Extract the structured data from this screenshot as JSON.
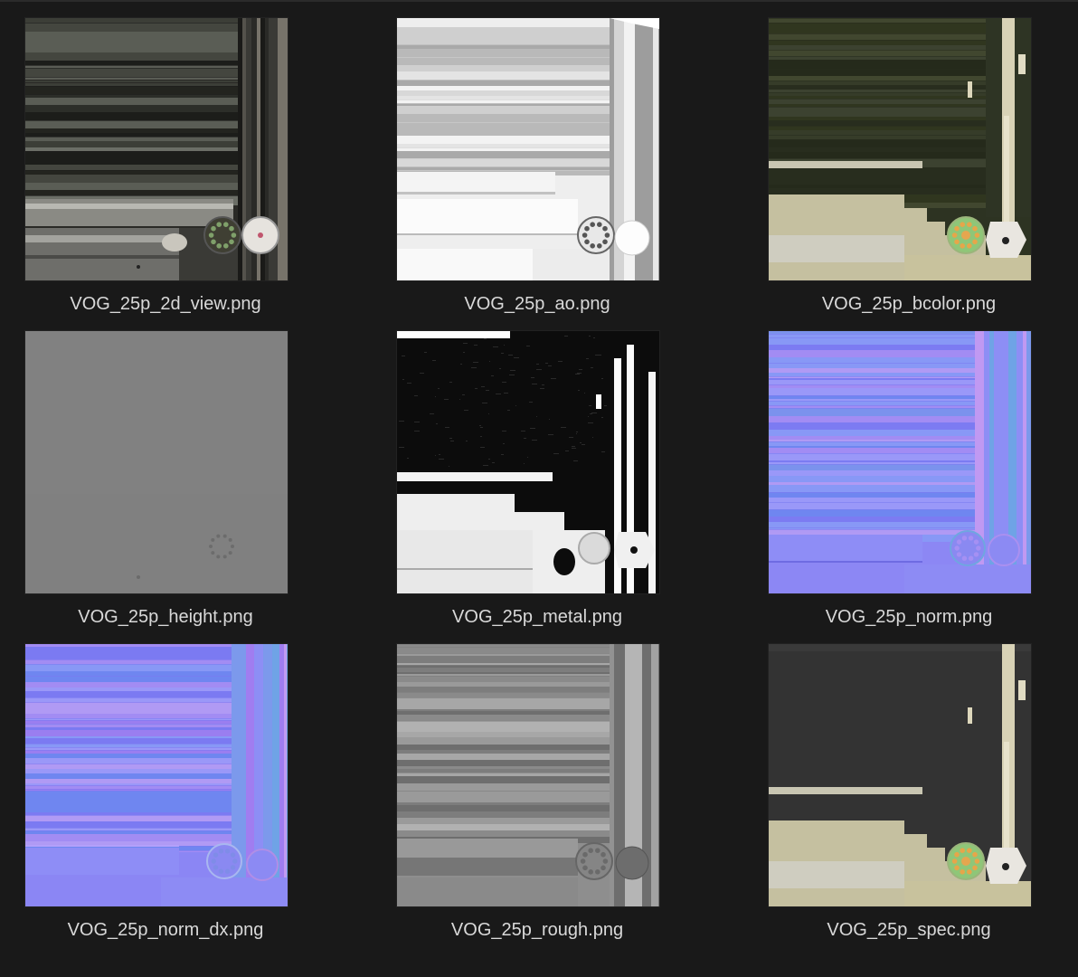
{
  "files": [
    {
      "name": "VOG_25p_2d_view.png",
      "icon": "texture-2d-view-thumbnail",
      "kind": "view"
    },
    {
      "name": "VOG_25p_ao.png",
      "icon": "texture-ao-thumbnail",
      "kind": "ao"
    },
    {
      "name": "VOG_25p_bcolor.png",
      "icon": "texture-bcolor-thumbnail",
      "kind": "bcolor"
    },
    {
      "name": "VOG_25p_height.png",
      "icon": "texture-height-thumbnail",
      "kind": "height"
    },
    {
      "name": "VOG_25p_metal.png",
      "icon": "texture-metal-thumbnail",
      "kind": "metal"
    },
    {
      "name": "VOG_25p_norm.png",
      "icon": "texture-norm-thumbnail",
      "kind": "norm"
    },
    {
      "name": "VOG_25p_norm_dx.png",
      "icon": "texture-norm-dx-thumbnail",
      "kind": "norm_dx"
    },
    {
      "name": "VOG_25p_rough.png",
      "icon": "texture-rough-thumbnail",
      "kind": "rough"
    },
    {
      "name": "VOG_25p_spec.png",
      "icon": "texture-spec-thumbnail",
      "kind": "spec"
    }
  ],
  "colors": {
    "background": "#191919",
    "label": "#d9d9d9"
  }
}
